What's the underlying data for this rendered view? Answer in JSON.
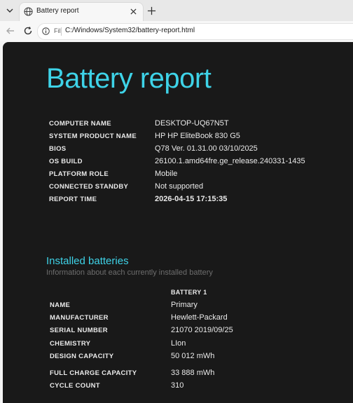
{
  "browser": {
    "tab_title": "Battery report",
    "address_scheme": "Fil",
    "address_url": "C:/Windows/System32/battery-report.html"
  },
  "report": {
    "title": "Battery report",
    "system_info": [
      {
        "label": "COMPUTER NAME",
        "value": "DESKTOP-UQ67N5T"
      },
      {
        "label": "SYSTEM PRODUCT NAME",
        "value": "HP HP EliteBook 830 G5"
      },
      {
        "label": "BIOS",
        "value": "Q78 Ver. 01.31.00 03/10/2025"
      },
      {
        "label": "OS BUILD",
        "value": "26100.1.amd64fre.ge_release.240331-1435"
      },
      {
        "label": "PLATFORM ROLE",
        "value": "Mobile"
      },
      {
        "label": "CONNECTED STANDBY",
        "value": "Not supported"
      },
      {
        "label": "REPORT TIME",
        "value": "2026-04-15  17:15:35"
      }
    ],
    "installed_batteries": {
      "title": "Installed batteries",
      "subtitle": "Information about each currently installed battery",
      "column_header": "BATTERY 1",
      "rows": [
        {
          "label": "NAME",
          "value": "Primary"
        },
        {
          "label": "MANUFACTURER",
          "value": "Hewlett-Packard"
        },
        {
          "label": "SERIAL NUMBER",
          "value": "21070 2019/09/25"
        },
        {
          "label": "CHEMISTRY",
          "value": "LIon"
        },
        {
          "label": "DESIGN CAPACITY",
          "value": "50 012 mWh"
        },
        {
          "label": "FULL CHARGE CAPACITY",
          "value": "33 888 mWh"
        },
        {
          "label": "CYCLE COUNT",
          "value": "310"
        }
      ]
    }
  },
  "colors": {
    "accent": "#3ed3e8",
    "page_background": "#191919",
    "text": "#eaeaea"
  }
}
